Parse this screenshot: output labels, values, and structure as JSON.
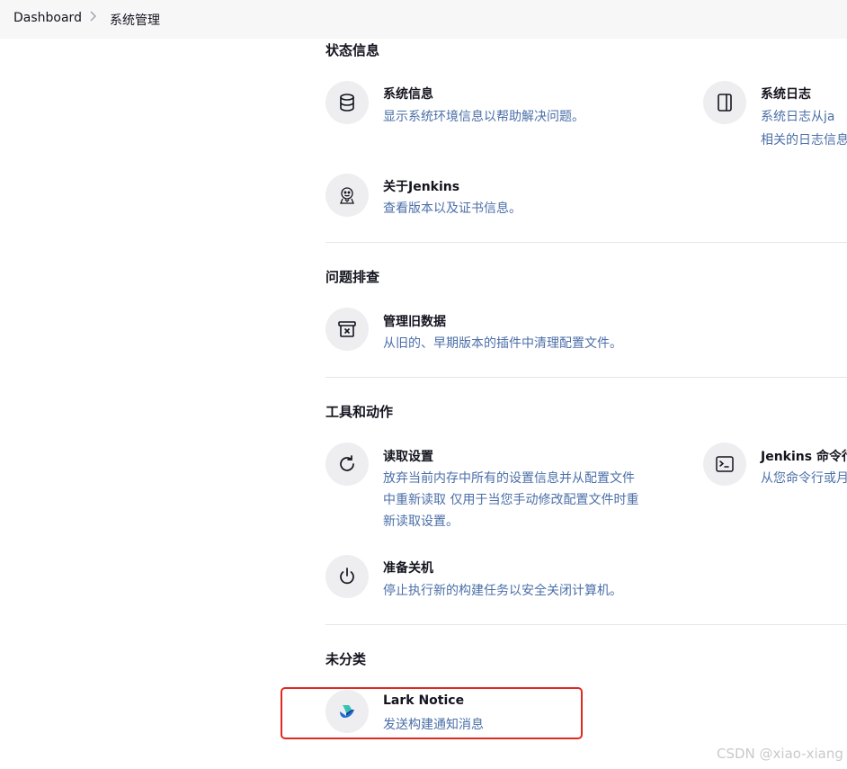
{
  "breadcrumb": {
    "root": "Dashboard",
    "separator": ">",
    "current": "系统管理"
  },
  "sections": {
    "status": {
      "title": "状态信息",
      "system_info": {
        "title": "系统信息",
        "desc": "显示系统环境信息以帮助解决问题。"
      },
      "system_log": {
        "title": "系统日志",
        "desc_line1": "系统日志从ja",
        "desc_line2": "相关的日志信息"
      },
      "about": {
        "title": "关于Jenkins",
        "desc": "查看版本以及证书信息。"
      }
    },
    "troubleshooting": {
      "title": "问题排查",
      "old_data": {
        "title": "管理旧数据",
        "desc": "从旧的、早期版本的插件中清理配置文件。"
      }
    },
    "tools": {
      "title": "工具和动作",
      "reload": {
        "title": "读取设置",
        "desc_line1": "放弃当前内存中所有的设置信息并从配置文件",
        "desc_line2": "中重新读取 仅用于当您手动修改配置文件时重",
        "desc_line3": "新读取设置。"
      },
      "cli": {
        "title": "Jenkins 命令行",
        "desc": "从您命令行或月"
      },
      "shutdown": {
        "title": "准备关机",
        "desc": "停止执行新的构建任务以安全关闭计算机。"
      }
    },
    "uncategorized": {
      "title": "未分类",
      "lark": {
        "title": "Lark Notice",
        "desc": "发送构建通知消息"
      }
    }
  },
  "watermark": "CSDN @xiao-xiang",
  "colors": {
    "link_desc": "#4b6fa8",
    "highlight": "#e02a1f",
    "icon_bg": "#eeeef1"
  },
  "icons": [
    "database-icon",
    "log-panel-icon",
    "jenkins-butler-icon",
    "archive-box-icon",
    "reload-icon",
    "terminal-icon",
    "power-icon",
    "lark-logo-icon"
  ]
}
